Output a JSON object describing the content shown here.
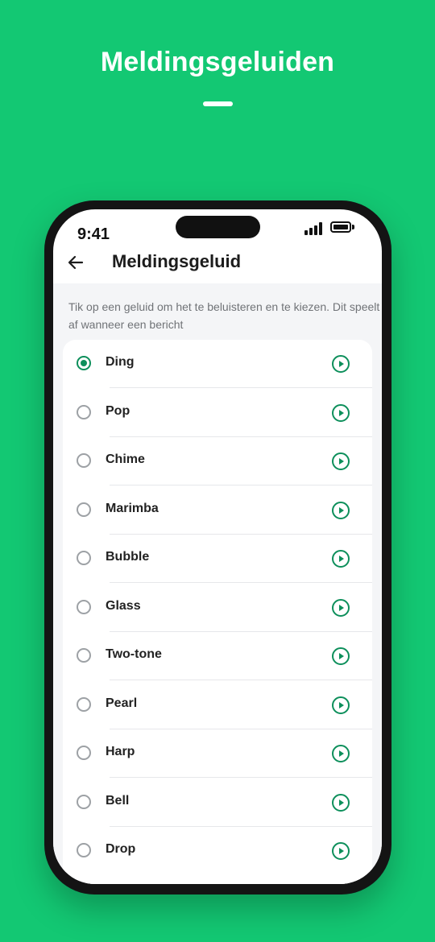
{
  "promo": {
    "title": "Meldingsgeluiden"
  },
  "status_bar": {
    "time": "9:41"
  },
  "app_bar": {
    "title": "Meldingsgeluid"
  },
  "description": "Tik op een geluid om het te beluisteren en te kiezen. Dit speelt af wanneer een bericht",
  "sounds": [
    {
      "label": "Ding",
      "selected": true
    },
    {
      "label": "Pop",
      "selected": false
    },
    {
      "label": "Chime",
      "selected": false
    },
    {
      "label": "Marimba",
      "selected": false
    },
    {
      "label": "Bubble",
      "selected": false
    },
    {
      "label": "Glass",
      "selected": false
    },
    {
      "label": "Two-tone",
      "selected": false
    },
    {
      "label": "Pearl",
      "selected": false
    },
    {
      "label": "Harp",
      "selected": false
    },
    {
      "label": "Bell",
      "selected": false
    },
    {
      "label": "Drop",
      "selected": false
    }
  ],
  "colors": {
    "brand_green": "#13c873",
    "accent": "#0d8f5b"
  },
  "icons": {
    "back": "arrow-left-icon",
    "play": "play-circle-icon",
    "radio": "radio-button-icon"
  }
}
